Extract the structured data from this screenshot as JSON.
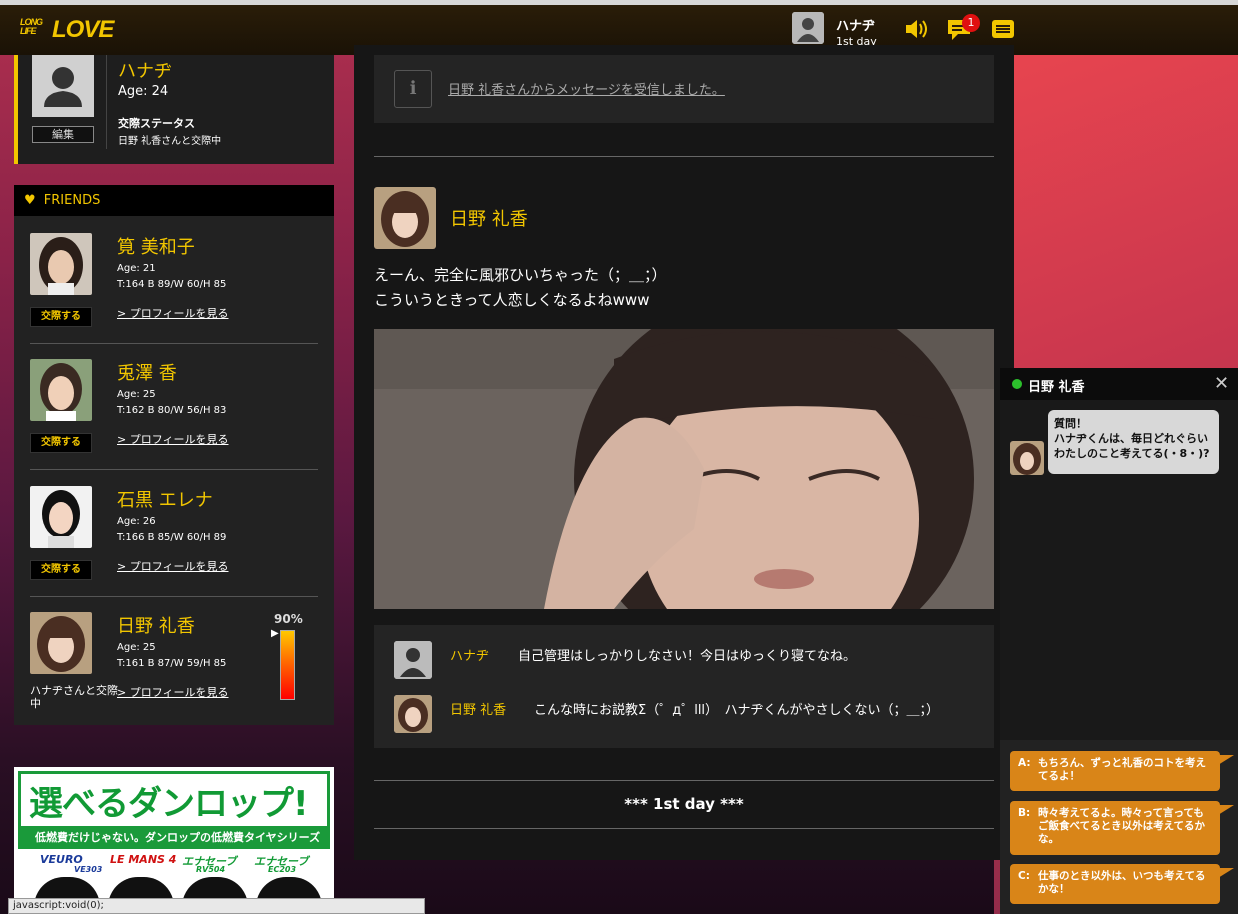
{
  "header": {
    "logo_small": "LONG LIFE",
    "logo_big": "LOVE",
    "user_name": "ハナヂ",
    "user_day": "1st day",
    "notif_count": "1",
    "icons": [
      "speaker-icon",
      "chat-bubble-icon",
      "menu-icon"
    ]
  },
  "profile": {
    "name": "ハナヂ",
    "age": "Age: 24",
    "edit_label": "編集",
    "status_label": "交際ステータス",
    "status_value": "日野 礼香さんと交際中"
  },
  "friends": {
    "title": "FRIENDS",
    "items": [
      {
        "name": "筧 美和子",
        "age": "Age: 21",
        "measurements": "T:164 B 89/W 60/H 85",
        "action": "交際する",
        "profile_link": "> プロフィールを見る"
      },
      {
        "name": "兎澤 香",
        "age": "Age: 25",
        "measurements": "T:162 B 80/W 56/H 83",
        "action": "交際する",
        "profile_link": "> プロフィールを見る"
      },
      {
        "name": "石黒 エレナ",
        "age": "Age: 26",
        "measurements": "T:166 B 85/W 60/H 89",
        "action": "交際する",
        "profile_link": "> プロフィールを見る"
      },
      {
        "name": "日野 礼香",
        "age": "Age: 25",
        "measurements": "T:161 B 87/W 59/H 85",
        "status": "ハナヂさんと交際中",
        "profile_link": "> プロフィールを見る",
        "love_meter": "90%",
        "love_meter_value": 0.9
      }
    ]
  },
  "ad": {
    "title": "選べるダンロップ!",
    "subtitle": "低燃費だけじゃない。ダンロップの低燃費タイヤシリーズ",
    "brands": [
      "VEURO",
      "LE MANS 4",
      "エナセーブ",
      "エナセーブ"
    ],
    "brand_sub": [
      "VE303",
      "",
      "RV504",
      "EC203"
    ]
  },
  "feed": {
    "notification": "日野 礼香さんからメッセージを受信しました。",
    "post_author": "日野 礼香",
    "post_line1": "えーん、完全に風邪ひいちゃった（；＿；）",
    "post_line2": "こういうときって人恋しくなるよねwww",
    "comments": [
      {
        "name": "ハナヂ",
        "text": "自己管理はしっかりしなさい！今日はゆっくり寝てなね。"
      },
      {
        "name": "日野 礼香",
        "text": "こんな時にお説教Σ（゜д゜lll）　ハナヂくんがやさしくない（；＿；）"
      }
    ],
    "day_marker": "*** 1st day ***"
  },
  "chat": {
    "name": "日野 礼香",
    "message_line1": "質問！",
    "message_line2": "ハナヂくんは、毎日どれぐらい",
    "message_line3": "わたしのこと考えてる(・8・)?",
    "replies": [
      {
        "key": "A:",
        "text": "もちろん、ずっと礼香のコトを考えてるよ！"
      },
      {
        "key": "B:",
        "text": "時々考えてるよ。時々って言ってもご飯食べてるとき以外は考えてるかな。"
      },
      {
        "key": "C:",
        "text": "仕事のとき以外は、いつも考えてるかな！"
      }
    ]
  },
  "statusbar": "javascript:void(0);",
  "colors": {
    "accent": "#f2c600",
    "panel": "#1e1e1e",
    "reply": "#d98518",
    "online": "#2cc02c"
  }
}
